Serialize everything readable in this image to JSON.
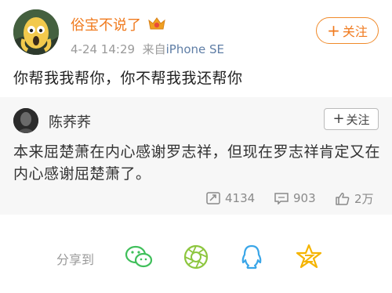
{
  "post": {
    "username": "俗宝不说了",
    "time": "4-24 14:29",
    "source_prefix": "来自",
    "source": "iPhone SE",
    "follow_label": "关注",
    "text": "你帮我我帮你，你不帮我我还帮你"
  },
  "repost": {
    "username": "陈荞荞",
    "follow_label": "关注",
    "text": "本来屈楚萧在内心感谢罗志祥，但现在罗志祥肯定又在内心感谢屈楚萧了。",
    "stats": {
      "reposts": "4134",
      "comments": "903",
      "likes": "2万"
    }
  },
  "share": {
    "label": "分享到",
    "targets": [
      "wechat-icon",
      "moments-icon",
      "qq-icon",
      "qzone-icon"
    ]
  },
  "colors": {
    "accent": "#f07a1e",
    "link": "#5f7ea6",
    "repost_bg": "#f7f7f7"
  }
}
